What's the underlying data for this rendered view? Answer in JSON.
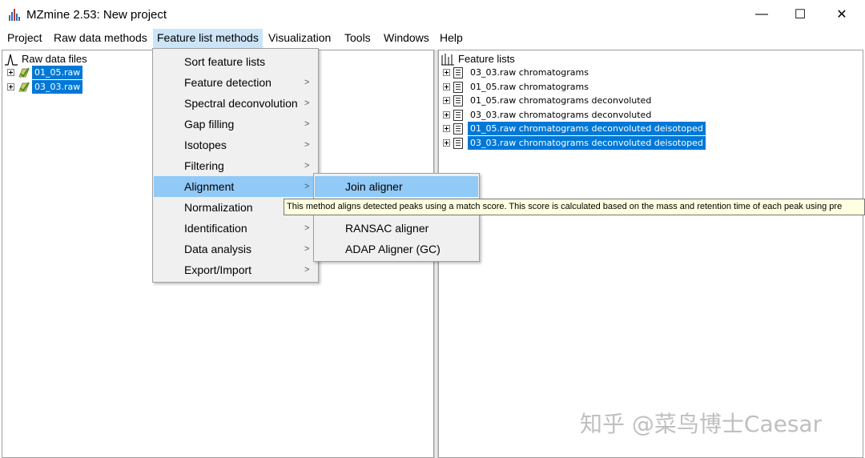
{
  "window": {
    "title": "MZmine 2.53: New project",
    "buttons": {
      "minimize": "—",
      "maximize": "☐",
      "close": "✕"
    }
  },
  "menubar": [
    {
      "label": "Project"
    },
    {
      "label": "Raw data methods"
    },
    {
      "label": "Feature list methods",
      "active": true
    },
    {
      "label": "Visualization"
    },
    {
      "label": "Tools"
    },
    {
      "label": "Windows"
    },
    {
      "label": "Help"
    }
  ],
  "left_pane": {
    "root_label": "Raw data files",
    "items": [
      {
        "label": "01_05.raw",
        "selected": true
      },
      {
        "label": "03_03.raw",
        "selected": true
      }
    ]
  },
  "right_pane": {
    "root_label": "Feature lists",
    "items": [
      {
        "label": "03_03.raw chromatograms",
        "selected": false
      },
      {
        "label": "01_05.raw chromatograms",
        "selected": false
      },
      {
        "label": "01_05.raw chromatograms deconvoluted",
        "selected": false
      },
      {
        "label": "03_03.raw chromatograms deconvoluted",
        "selected": false
      },
      {
        "label": "01_05.raw chromatograms deconvoluted deisotoped",
        "selected": true
      },
      {
        "label": "03_03.raw chromatograms deconvoluted deisotoped",
        "selected": true
      }
    ]
  },
  "dropdown": [
    {
      "label": "Sort feature lists",
      "submenu": false
    },
    {
      "label": "Feature detection",
      "submenu": true
    },
    {
      "label": "Spectral deconvolution",
      "submenu": true
    },
    {
      "label": "Gap filling",
      "submenu": true
    },
    {
      "label": "Isotopes",
      "submenu": true
    },
    {
      "label": "Filtering",
      "submenu": true
    },
    {
      "label": "Alignment",
      "submenu": true,
      "active": true
    },
    {
      "label": "Normalization",
      "submenu": true
    },
    {
      "label": "Identification",
      "submenu": true
    },
    {
      "label": "Data analysis",
      "submenu": true
    },
    {
      "label": "Export/Import",
      "submenu": true
    }
  ],
  "arrow_glyph": ">",
  "submenu": [
    {
      "label": "Join aligner",
      "active": true
    },
    {
      "label": ""
    },
    {
      "label": "RANSAC aligner"
    },
    {
      "label": "ADAP Aligner (GC)"
    }
  ],
  "tooltip": "This method aligns detected peaks using a match score. This score is calculated based on the mass and retention time of each peak using pre",
  "watermark": "知乎 @菜鸟博士Caesar",
  "colors": {
    "selection": "#0078d7",
    "menu_active": "#cce4f7",
    "dropdown_highlight": "#91c9f7",
    "tooltip_bg": "#ffffe1"
  }
}
